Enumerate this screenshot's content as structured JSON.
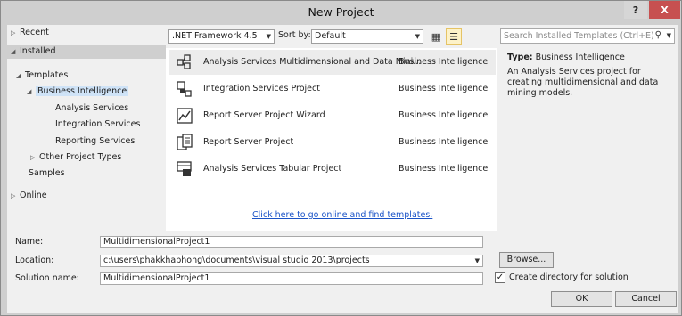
{
  "window": {
    "title": "New Project",
    "help_label": "?",
    "close_label": "X"
  },
  "tree": {
    "recent": "Recent",
    "installed": "Installed",
    "templates": "Templates",
    "business_intelligence": "Business Intelligence",
    "analysis_services": "Analysis Services",
    "integration_services": "Integration Services",
    "reporting_services": "Reporting Services",
    "other_project_types": "Other Project Types",
    "samples": "Samples",
    "online": "Online"
  },
  "toolbar": {
    "framework": ".NET Framework 4.5",
    "sort_label": "Sort by:",
    "sort_value": "Default"
  },
  "templates": [
    {
      "name": "Analysis Services Multidimensional and Data Mini...",
      "category": "Business Intelligence"
    },
    {
      "name": "Integration Services Project",
      "category": "Business Intelligence"
    },
    {
      "name": "Report Server Project Wizard",
      "category": "Business Intelligence"
    },
    {
      "name": "Report Server Project",
      "category": "Business Intelligence"
    },
    {
      "name": "Analysis Services Tabular Project",
      "category": "Business Intelligence"
    }
  ],
  "online_link": "Click here to go online and find templates.",
  "search": {
    "placeholder": "Search Installed Templates (Ctrl+E)"
  },
  "description": {
    "type_label": "Type:",
    "type_value": "Business Intelligence",
    "text": "An Analysis Services project for creating multidimensional and data mining models."
  },
  "form": {
    "name_label": "Name:",
    "name_value": "MultidimensionalProject1",
    "location_label": "Location:",
    "location_value": "c:\\users\\phakkhaphong\\documents\\visual studio 2013\\projects",
    "solution_label": "Solution name:",
    "solution_value": "MultidimensionalProject1",
    "browse_label": "Browse...",
    "create_dir_label": "Create directory for solution",
    "create_dir_checked": true,
    "ok_label": "OK",
    "cancel_label": "Cancel"
  },
  "colors": {
    "link": "#1a53c7",
    "close_button": "#c75050",
    "selection": "#cfe3f7"
  }
}
